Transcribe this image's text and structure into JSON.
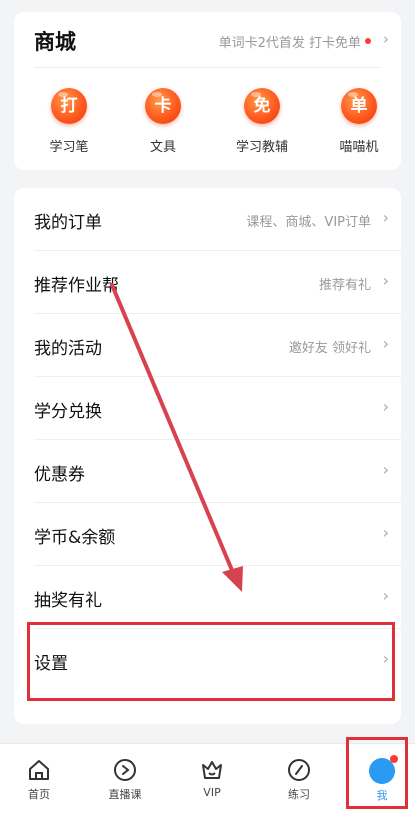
{
  "mall": {
    "title": "商城",
    "promo_text": "单词卡2代首发 打卡免单",
    "items": [
      {
        "badge": "打",
        "label": "学习笔"
      },
      {
        "badge": "卡",
        "label": "文具"
      },
      {
        "badge": "免",
        "label": "学习教辅"
      },
      {
        "badge": "单",
        "label": "喵喵机"
      }
    ]
  },
  "menu": {
    "items": [
      {
        "label": "我的订单",
        "value": "课程、商城、VIP订单"
      },
      {
        "label": "推荐作业帮",
        "value": "推荐有礼"
      },
      {
        "label": "我的活动",
        "value": "邀好友 领好礼"
      },
      {
        "label": "学分兑换",
        "value": ""
      },
      {
        "label": "优惠券",
        "value": ""
      },
      {
        "label": "学币&余额",
        "value": ""
      },
      {
        "label": "抽奖有礼",
        "value": ""
      },
      {
        "label": "设置",
        "value": ""
      }
    ],
    "chevron": "›"
  },
  "tabbar": {
    "items": [
      {
        "label": "首页",
        "icon": "home-icon"
      },
      {
        "label": "直播课",
        "icon": "play-icon"
      },
      {
        "label": "VIP",
        "icon": "crown-icon"
      },
      {
        "label": "练习",
        "icon": "pen-icon"
      },
      {
        "label": "我",
        "icon": "profile-icon"
      }
    ]
  },
  "colors": {
    "accent_orange": "#ff5a1f",
    "annotation_red": "#e0313a",
    "active_blue": "#2b9af3"
  }
}
